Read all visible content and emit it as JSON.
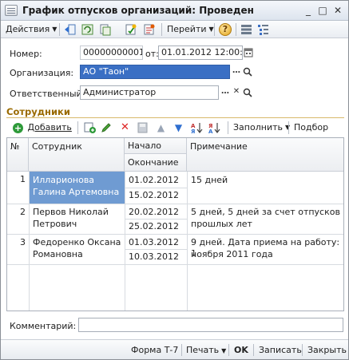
{
  "window": {
    "title": "График отпусков организаций: Проведен"
  },
  "toolbar": {
    "actions_label": "Действия",
    "go_label": "Перейти",
    "help_label": "?"
  },
  "form": {
    "number_label": "Номер:",
    "number_value": "00000000001",
    "from_label": "от:",
    "date_value": "01.01.2012 12:00:00",
    "org_label": "Организация:",
    "org_value": "АО \"Таон\"",
    "resp_label": "Ответственный:",
    "resp_value": "Администратор"
  },
  "section": {
    "title": "Сотрудники"
  },
  "table_toolbar": {
    "add_label": "Добавить",
    "fill_label": "Заполнить",
    "select_label": "Подбор"
  },
  "table": {
    "columns": {
      "num": "№",
      "employee": "Сотрудник",
      "start": "Начало",
      "end": "Окончание",
      "note": "Примечание"
    },
    "rows": [
      {
        "num": "1",
        "name1": "Илларионова",
        "name2": "Галина Артемовна",
        "start": "01.02.2012",
        "end": "15.02.2012",
        "note1": "15 дней",
        "note2": ""
      },
      {
        "num": "2",
        "name1": "Первов Николай",
        "name2": "Петрович",
        "start": "20.02.2012",
        "end": "25.02.2012",
        "note1": "5 дней, 5 дней за счет отпусков",
        "note2": "прошлых лет"
      },
      {
        "num": "3",
        "name1": "Федоренко Оксана",
        "name2": "Романовна",
        "start": "01.03.2012",
        "end": "10.03.2012",
        "note1": "9 дней. Дата приема на работу: 1",
        "note2": "ноября 2011 года"
      }
    ]
  },
  "comment": {
    "label": "Комментарий:",
    "value": ""
  },
  "bottom": {
    "form_t7": "Форма Т-7",
    "print": "Печать",
    "ok": "OK",
    "save": "Записать",
    "close": "Закрыть"
  }
}
